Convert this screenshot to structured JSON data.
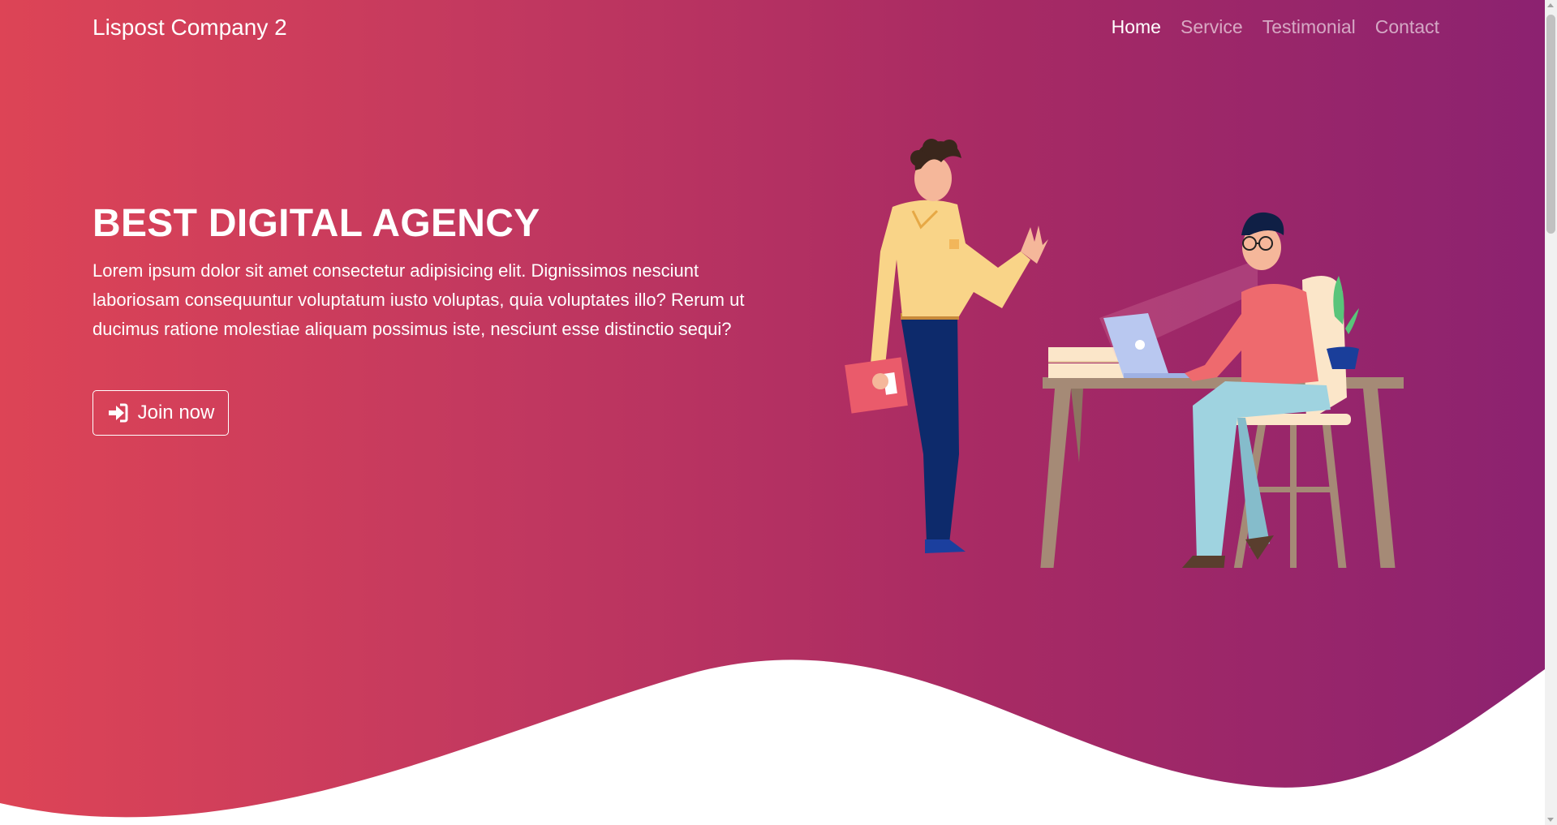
{
  "nav": {
    "brand": "Lispost Company 2",
    "links": [
      {
        "label": "Home",
        "active": true
      },
      {
        "label": "Service",
        "active": false
      },
      {
        "label": "Testimonial",
        "active": false
      },
      {
        "label": "Contact",
        "active": false
      }
    ]
  },
  "hero": {
    "title": "BEST DIGITAL AGENCY",
    "description": "Lorem ipsum dolor sit amet consectetur adipisicing elit. Dignissimos nesciunt laboriosam consequuntur voluptatum iusto voluptas, quia voluptates illo? Rerum ut ducimus ratione molestiae aliquam possimus iste, nesciunt esse distinctio sequi?",
    "cta_label": "Join now",
    "cta_icon": "sign-in-icon",
    "illustration": "office-workers-illustration"
  },
  "colors": {
    "gradient_start": "#dd4456",
    "gradient_end": "#8c2270",
    "text": "#ffffff"
  }
}
